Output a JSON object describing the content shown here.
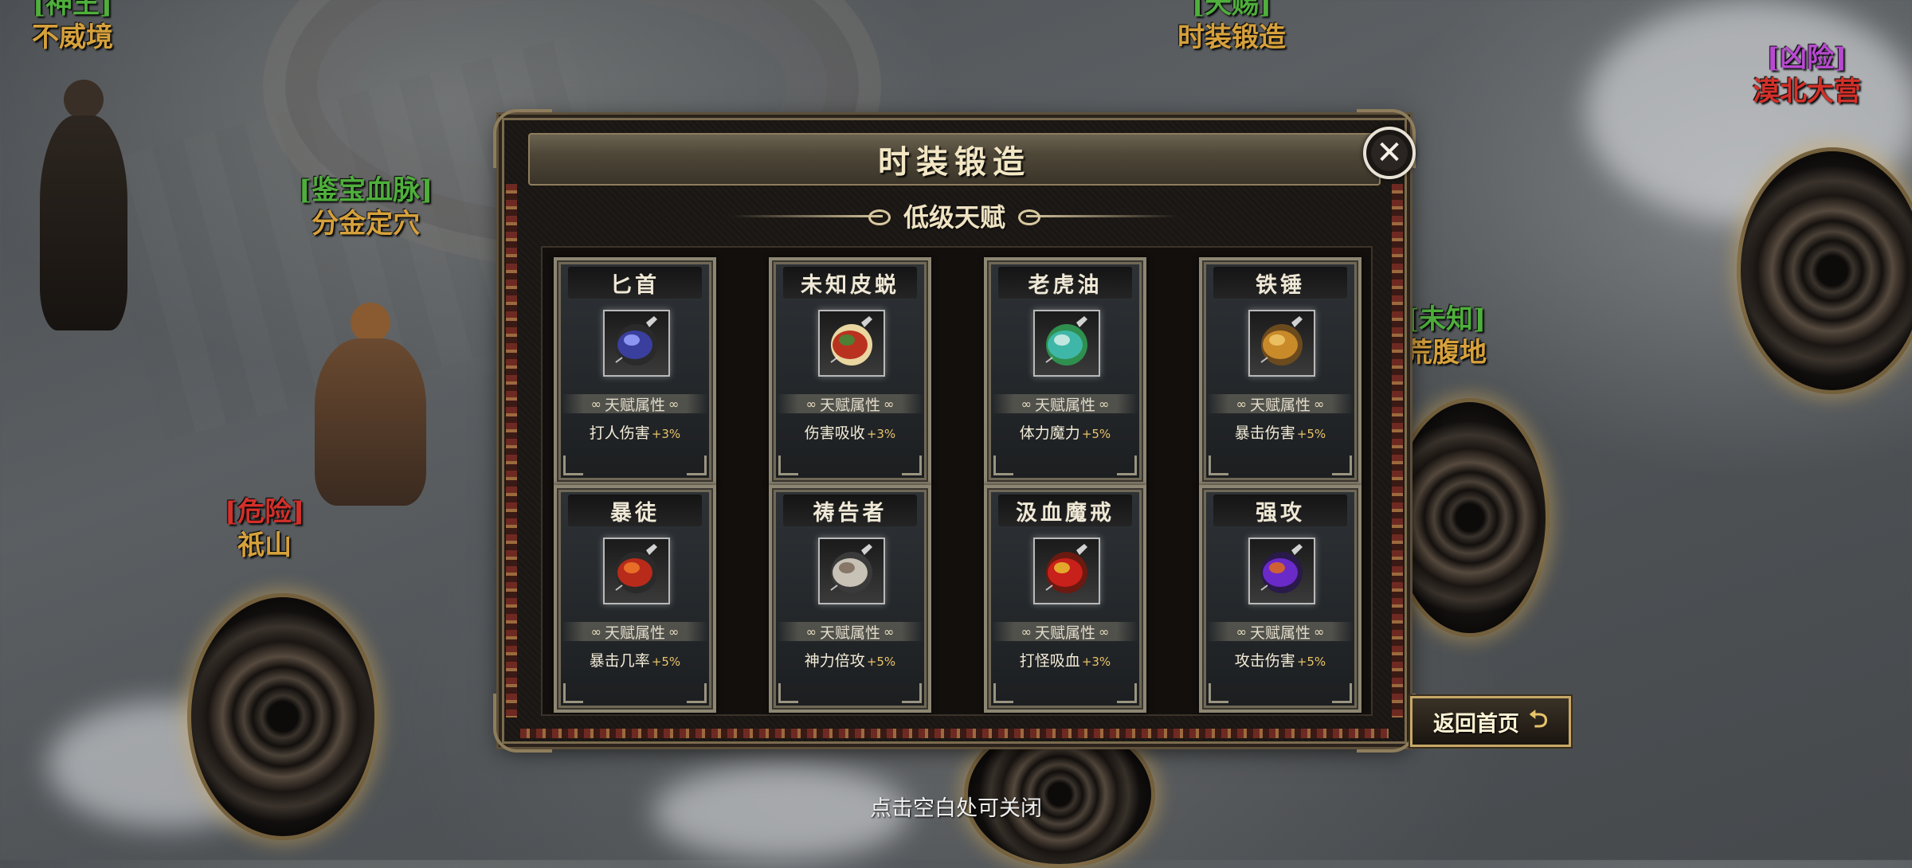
{
  "world": {
    "labels": [
      {
        "tag": "[神王]",
        "name": "不威境"
      },
      {
        "tag": "[天赐]",
        "name": "时装锻造"
      },
      {
        "tag": "[凶险]",
        "name": "漠北大营"
      },
      {
        "tag": "[鉴宝血脉]",
        "name": "分金定穴"
      },
      {
        "tag": "[未知]",
        "name": "荒腹地"
      },
      {
        "tag": "[危险]",
        "name": "祇山"
      }
    ]
  },
  "panel": {
    "title": "时装锻造",
    "subtitle": "低级天赋",
    "close_symbol": "✕",
    "attr_title": "天赋属性",
    "cards": [
      {
        "name": "匕首",
        "attr": "打人伤害",
        "bonus": "+3%",
        "icon": "dagger-icon",
        "colors": [
          "#3a3f9e",
          "#9aa6ff",
          "#2a2a2a"
        ]
      },
      {
        "name": "未知皮蜕",
        "attr": "伤害吸收",
        "bonus": "+3%",
        "icon": "shed-skin-icon",
        "colors": [
          "#b8321f",
          "#3b8d3a",
          "#e9d6a0"
        ]
      },
      {
        "name": "老虎油",
        "attr": "体力魔力",
        "bonus": "+5%",
        "icon": "tiger-oil-icon",
        "colors": [
          "#3fb7a8",
          "#d8f0ea",
          "#2f8f4e"
        ]
      },
      {
        "name": "铁锤",
        "attr": "暴击伤害",
        "bonus": "+5%",
        "icon": "hammer-icon",
        "colors": [
          "#c98a2a",
          "#f0c868",
          "#6b4a1e"
        ]
      },
      {
        "name": "暴徒",
        "attr": "暴击几率",
        "bonus": "+5%",
        "icon": "brute-icon",
        "colors": [
          "#b82a1a",
          "#f07a2a",
          "#2a2a2a"
        ]
      },
      {
        "name": "祷告者",
        "attr": "神力倍攻",
        "bonus": "+5%",
        "icon": "prayer-icon",
        "colors": [
          "#c8c2b6",
          "#7a6a5a",
          "#3a3a3a"
        ]
      },
      {
        "name": "汲血魔戒",
        "attr": "打怪吸血",
        "bonus": "+3%",
        "icon": "blood-ring-icon",
        "colors": [
          "#c8201a",
          "#e8c030",
          "#6a1a10"
        ]
      },
      {
        "name": "强攻",
        "attr": "攻击伤害",
        "bonus": "+5%",
        "icon": "assault-icon",
        "colors": [
          "#6a2ac8",
          "#e06a1a",
          "#2a1a4a"
        ]
      }
    ]
  },
  "return_button": {
    "label": "返回首页",
    "icon_symbol": "⮌"
  },
  "hint": "点击空白处可关闭"
}
